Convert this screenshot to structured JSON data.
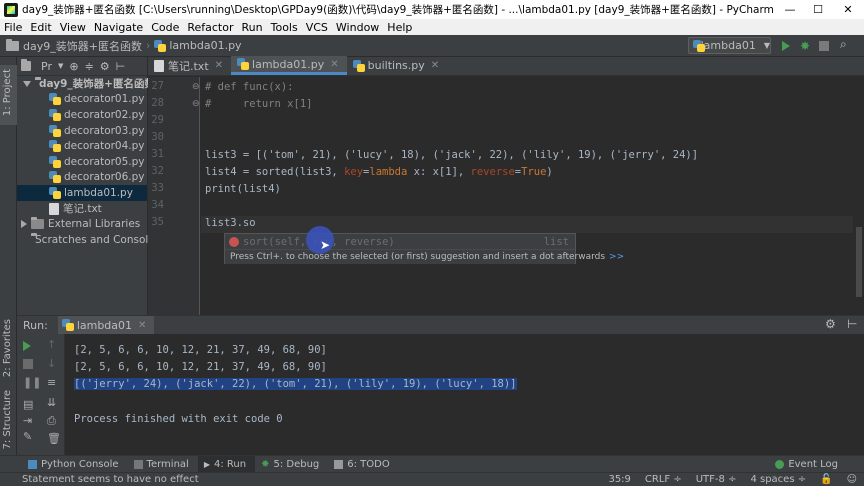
{
  "window": {
    "title": "day9_装饰器+匿名函数 [C:\\Users\\running\\Desktop\\GPDay9(函数)\\代码\\day9_装饰器+匿名函数] - ...\\lambda01.py [day9_装饰器+匿名函数] - PyCharm (Administrator)",
    "minimize": "—",
    "maximize": "☐",
    "close": "✕"
  },
  "menu": [
    "File",
    "Edit",
    "View",
    "Navigate",
    "Code",
    "Refactor",
    "Run",
    "Tools",
    "VCS",
    "Window",
    "Help"
  ],
  "navbar": {
    "project_crumb": "day9_装饰器+匿名函数",
    "file_crumb": "lambda01.py",
    "run_config": "lambda01"
  },
  "project_panel": {
    "header_label": "Pr",
    "root": "day9_装饰器+匿名函数",
    "files": [
      "decorator01.py",
      "decorator02.py",
      "decorator03.py",
      "decorator04.py",
      "decorator05.py",
      "decorator06.py",
      "lambda01.py",
      "笔记.txt"
    ],
    "external": "External Libraries",
    "scratches": "Scratches and Console"
  },
  "left_strip": {
    "project": "1: Project",
    "favorites": "2: Favorites",
    "structure": "7: Structure"
  },
  "tabs": [
    "笔记.txt",
    "lambda01.py",
    "builtins.py"
  ],
  "editor": {
    "line_numbers": [
      "27",
      "28",
      "29",
      "30",
      "31",
      "32",
      "33",
      "34",
      "35"
    ],
    "line27": "# def func(x):",
    "line28": "#     return x[1]",
    "line31": "list3 = [('tom', 21), ('lucy', 18), ('jack', 22), ('lily', 19), ('jerry', 24)]",
    "line32_a": "list4 = sorted(list3, ",
    "line32_key": "key",
    "line32_b": "=",
    "line32_lambda": "lambda",
    "line32_c": " x: x[1], ",
    "line32_rev": "reverse",
    "line32_d": "=",
    "line32_true": "True",
    "line32_e": ")",
    "line33": "print(list4)",
    "line35": "list3.so"
  },
  "completion": {
    "item": "sort(self, key, reverse)",
    "type": "list",
    "hint": "Press Ctrl+. to choose the selected (or first) suggestion and insert a dot afterwards",
    "hint_link": ">>"
  },
  "run": {
    "label": "Run:",
    "config": "lambda01",
    "output": [
      "[2, 5, 6, 6, 10, 12, 21, 37, 49, 68, 90]",
      "[2, 5, 6, 6, 10, 12, 21, 37, 49, 68, 90]",
      "[('jerry', 24), ('jack', 22), ('tom', 21), ('lily', 19), ('lucy', 18)]",
      "",
      "Process finished with exit code 0"
    ]
  },
  "bottom_tabs": [
    "Python Console",
    "Terminal",
    "4: Run",
    "5: Debug",
    "6: TODO"
  ],
  "event_log": "Event Log",
  "status": {
    "message": "Statement seems to have no effect",
    "position": "35:9",
    "line_sep": "CRLF ÷",
    "encoding": "UTF-8 ÷",
    "indent": "4 spaces ÷"
  },
  "colors": {
    "accent": "#4a88c7",
    "selection": "#214283",
    "run_green": "#499c54"
  }
}
